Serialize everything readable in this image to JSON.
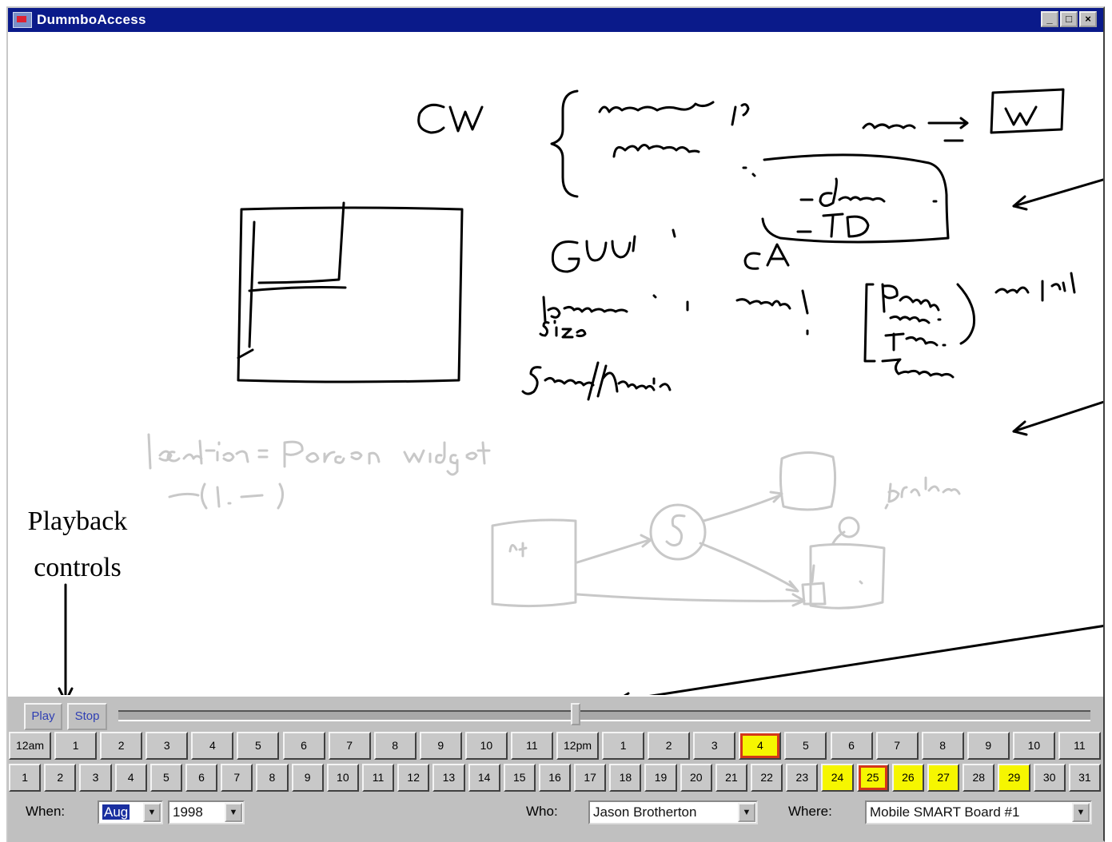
{
  "window": {
    "title": "DummboAccess",
    "minimize_label": "_",
    "maximize_label": "□",
    "close_label": "×"
  },
  "annotation": {
    "line1": "Playback",
    "line2": "controls"
  },
  "whiteboard": {
    "dark_ink_color": "#000000",
    "faded_ink_color": "#c8c8c8"
  },
  "playback": {
    "play_label": "Play",
    "stop_label": "Stop",
    "position": 0.47
  },
  "hours": {
    "labels": [
      "12am",
      "1",
      "2",
      "3",
      "4",
      "5",
      "6",
      "7",
      "8",
      "9",
      "10",
      "11",
      "12pm",
      "1",
      "2",
      "3",
      "4",
      "5",
      "6",
      "7",
      "8",
      "9",
      "10",
      "11"
    ],
    "highlighted_index": 16,
    "selected_index": 16
  },
  "days": {
    "labels": [
      "1",
      "2",
      "3",
      "4",
      "5",
      "6",
      "7",
      "8",
      "9",
      "10",
      "11",
      "12",
      "13",
      "14",
      "15",
      "16",
      "17",
      "18",
      "19",
      "20",
      "21",
      "22",
      "23",
      "24",
      "25",
      "26",
      "27",
      "28",
      "29",
      "30",
      "31"
    ],
    "highlighted": [
      "24",
      "25",
      "26",
      "27",
      "29"
    ],
    "selected": "25"
  },
  "when": {
    "label": "When:",
    "month": "Aug",
    "year": "1998"
  },
  "who": {
    "label": "Who:",
    "value": "Jason Brotherton"
  },
  "where": {
    "label": "Where:",
    "value": "Mobile SMART Board #1"
  },
  "colors": {
    "titlebar": "#0a1a8a",
    "highlight": "#f6f600",
    "selected_border": "#d4381a",
    "button_text": "#2f3fb3"
  }
}
